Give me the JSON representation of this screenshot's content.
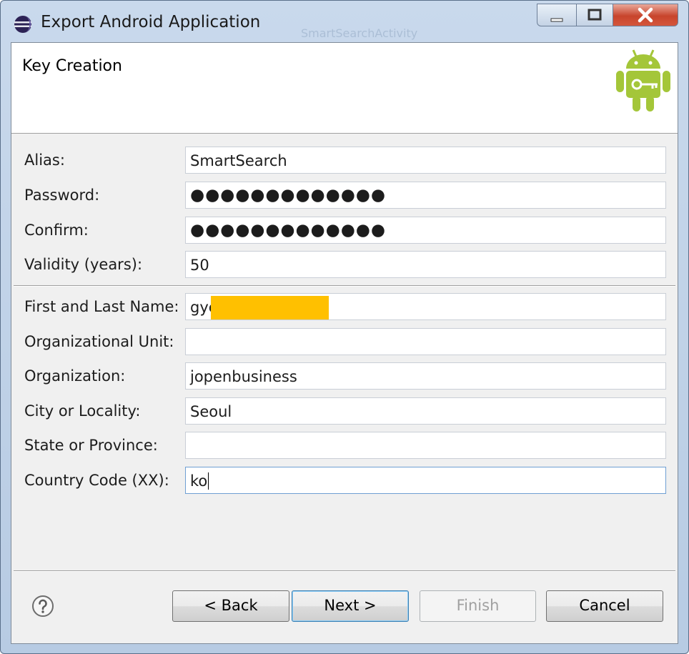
{
  "window": {
    "title": "Export Android Application",
    "background_text": "SmartSearchActivity"
  },
  "header": {
    "title": "Key Creation",
    "icon": "android-key-icon"
  },
  "form": {
    "key_fields": [
      {
        "label": "Alias:",
        "value": "SmartSearch"
      },
      {
        "label": "Password:",
        "value": "●●●●●●●●●●●●●"
      },
      {
        "label": "Confirm:",
        "value": "●●●●●●●●●●●●●"
      },
      {
        "label": "Validity (years):",
        "value": "50"
      }
    ],
    "dn_fields": [
      {
        "label": "First and Last Name:",
        "value": "gye"
      },
      {
        "label": "Organizational Unit:",
        "value": ""
      },
      {
        "label": "Organization:",
        "value": "jopenbusiness"
      },
      {
        "label": "City or Locality:",
        "value": "Seoul"
      },
      {
        "label": "State or Province:",
        "value": ""
      },
      {
        "label": "Country Code (XX):",
        "value": "ko"
      }
    ]
  },
  "buttons": {
    "back": "< Back",
    "next": "Next >",
    "finish": "Finish",
    "cancel": "Cancel"
  },
  "colors": {
    "accent": "#3c7fb1",
    "android_green": "#a4c639",
    "redaction": "#ffc000"
  }
}
